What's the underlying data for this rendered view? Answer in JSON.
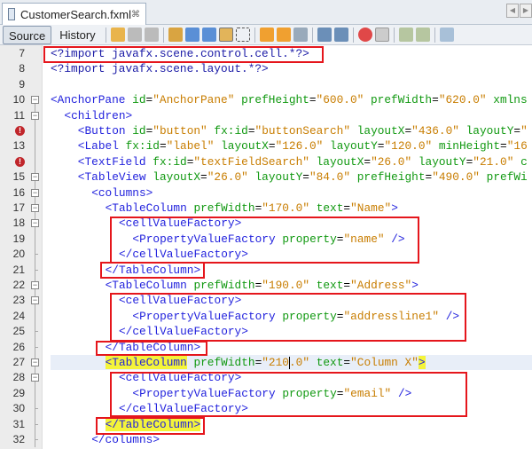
{
  "tab": {
    "title": "CustomerSearch.fxml",
    "close": "⌘"
  },
  "toolbar": {
    "source": "Source",
    "history": "History"
  },
  "colors": {
    "highlight": "#f4f43a",
    "box": "#e5161c",
    "error": "#c0262b"
  },
  "lines": [
    {
      "n": "7",
      "indent": 0,
      "text": "<?import javafx.scene.control.cell.*?>",
      "pi": true
    },
    {
      "n": "8",
      "indent": 0,
      "text": "<?import javafx.scene.layout.*?>",
      "pi": true
    },
    {
      "n": "9",
      "indent": 0,
      "text": ""
    },
    {
      "n": "10",
      "indent": 0,
      "text": "<AnchorPane id=\"AnchorPane\" prefHeight=\"600.0\" prefWidth=\"620.0\" xmlns",
      "fold": "open"
    },
    {
      "n": "11",
      "indent": 1,
      "text": "<children>",
      "fold": "open"
    },
    {
      "n": "12",
      "indent": 2,
      "text": "<Button id=\"button\" fx:id=\"buttonSearch\" layoutX=\"436.0\" layoutY=\"",
      "error": true
    },
    {
      "n": "13",
      "indent": 2,
      "text": "<Label fx:id=\"label\" layoutX=\"126.0\" layoutY=\"120.0\" minHeight=\"16"
    },
    {
      "n": "14",
      "indent": 2,
      "text": "<TextField fx:id=\"textFieldSearch\" layoutX=\"26.0\" layoutY=\"21.0\" c",
      "error": true
    },
    {
      "n": "15",
      "indent": 2,
      "text": "<TableView layoutX=\"26.0\" layoutY=\"84.0\" prefHeight=\"490.0\" prefWi",
      "fold": "open"
    },
    {
      "n": "16",
      "indent": 3,
      "text": "<columns>",
      "fold": "open"
    },
    {
      "n": "17",
      "indent": 4,
      "text": "<TableColumn prefWidth=\"170.0\" text=\"Name\">",
      "fold": "open"
    },
    {
      "n": "18",
      "indent": 5,
      "text": "<cellValueFactory>",
      "fold": "open"
    },
    {
      "n": "19",
      "indent": 6,
      "text": "<PropertyValueFactory property=\"name\" />"
    },
    {
      "n": "20",
      "indent": 5,
      "text": "</cellValueFactory>",
      "fold": "end"
    },
    {
      "n": "21",
      "indent": 4,
      "text": "</TableColumn>",
      "fold": "end"
    },
    {
      "n": "22",
      "indent": 4,
      "text": "<TableColumn prefWidth=\"190.0\" text=\"Address\">",
      "fold": "open"
    },
    {
      "n": "23",
      "indent": 5,
      "text": "<cellValueFactory>",
      "fold": "open"
    },
    {
      "n": "24",
      "indent": 6,
      "text": "<PropertyValueFactory property=\"addressline1\" />"
    },
    {
      "n": "25",
      "indent": 5,
      "text": "</cellValueFactory>",
      "fold": "end"
    },
    {
      "n": "26",
      "indent": 4,
      "text": "</TableColumn>",
      "fold": "end"
    },
    {
      "n": "27",
      "indent": 4,
      "text": "<TableColumn prefWidth=\"210.0\" text=\"Column X\">",
      "fold": "open",
      "current": true,
      "highlight": true,
      "cursor": 27
    },
    {
      "n": "28",
      "indent": 5,
      "text": "<cellValueFactory>",
      "fold": "open"
    },
    {
      "n": "29",
      "indent": 6,
      "text": "<PropertyValueFactory property=\"email\" />"
    },
    {
      "n": "30",
      "indent": 5,
      "text": "</cellValueFactory>",
      "fold": "end"
    },
    {
      "n": "31",
      "indent": 4,
      "text": "</TableColumn>",
      "fold": "end",
      "highlight": true
    },
    {
      "n": "32",
      "indent": 3,
      "text": "</columns>",
      "fold": "end"
    }
  ]
}
